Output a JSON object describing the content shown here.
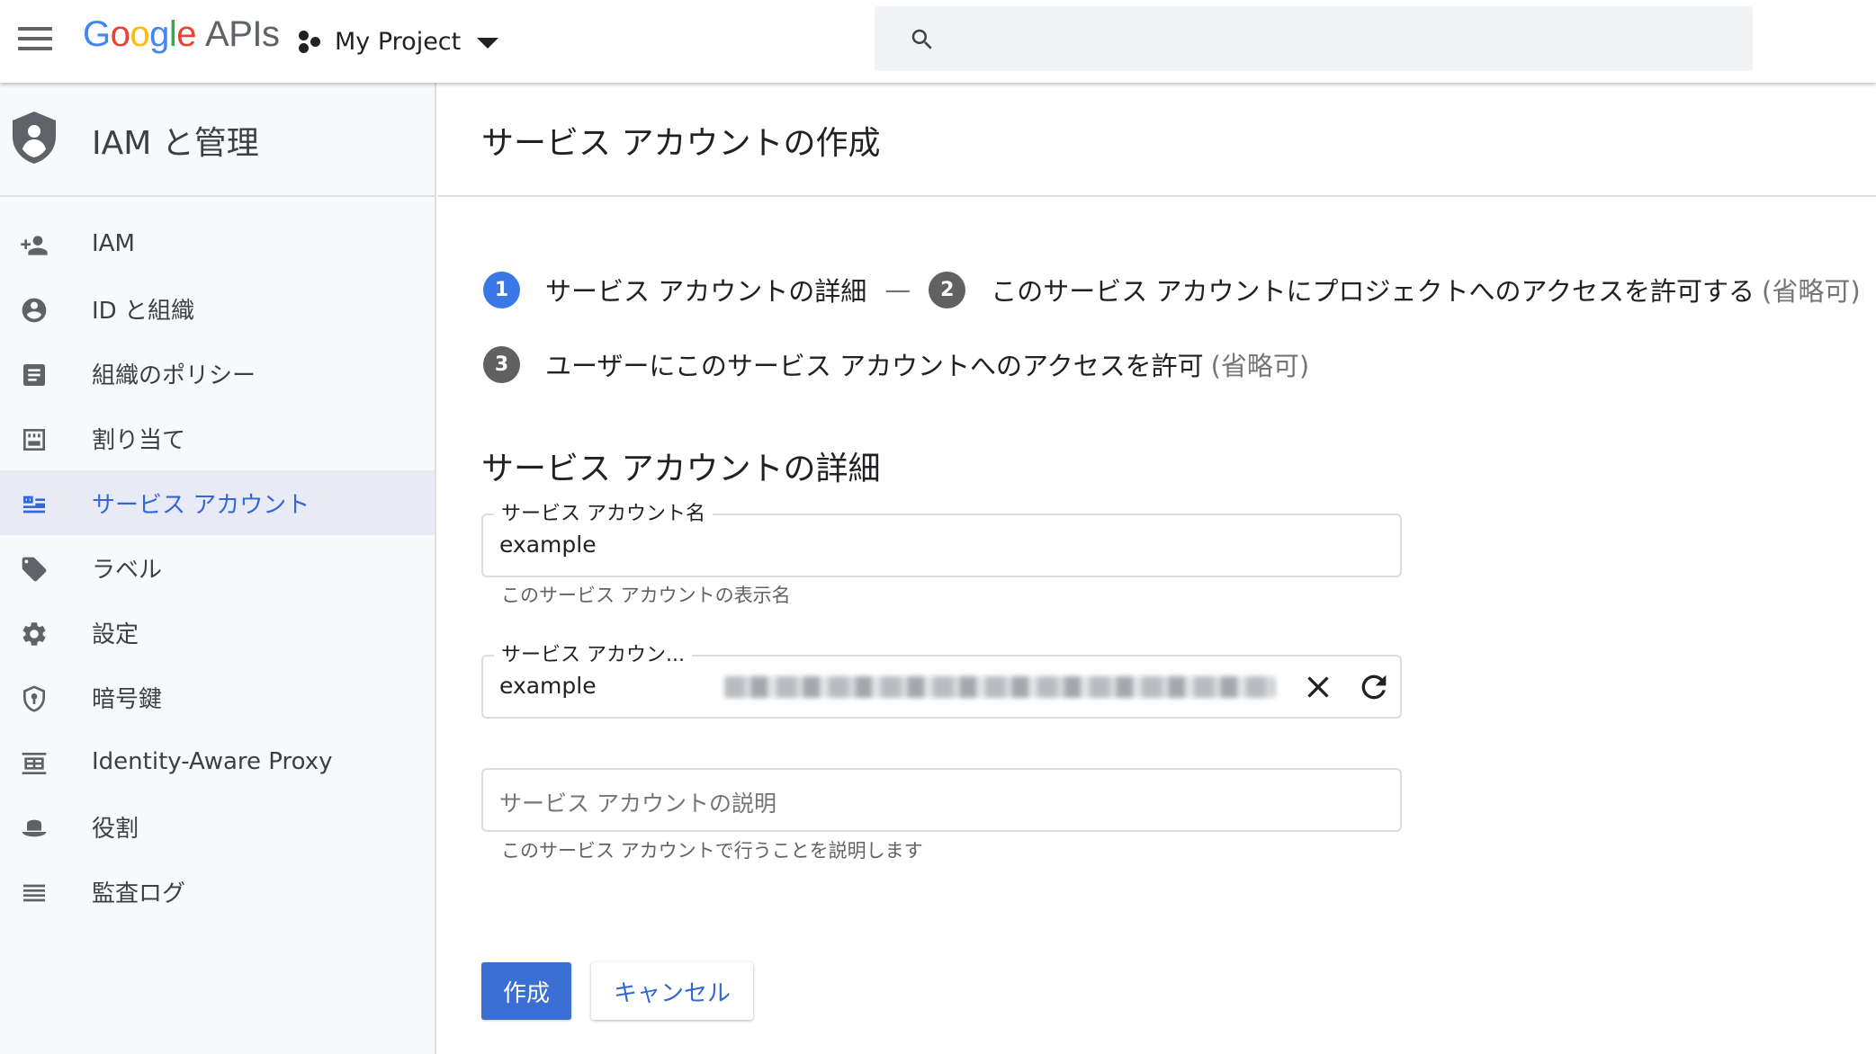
{
  "header": {
    "logo_google": "Google",
    "logo_apis": "APIs",
    "project_name": "My Project"
  },
  "sidebar": {
    "title": "IAM と管理",
    "items": [
      {
        "label": "IAM",
        "icon": "person-add-icon"
      },
      {
        "label": "ID と組織",
        "icon": "account-circle-icon"
      },
      {
        "label": "組織のポリシー",
        "icon": "document-icon"
      },
      {
        "label": "割り当て",
        "icon": "quota-icon"
      },
      {
        "label": "サービス アカウント",
        "icon": "service-account-icon",
        "active": true
      },
      {
        "label": "ラベル",
        "icon": "label-tag-icon"
      },
      {
        "label": "設定",
        "icon": "gear-icon"
      },
      {
        "label": "暗号鍵",
        "icon": "shield-key-icon"
      },
      {
        "label": "Identity-Aware Proxy",
        "icon": "proxy-icon"
      },
      {
        "label": "役割",
        "icon": "hat-icon"
      },
      {
        "label": "監査ログ",
        "icon": "list-icon"
      }
    ]
  },
  "main": {
    "title": "サービス アカウントの作成",
    "steps": [
      {
        "number": "1",
        "label": "サービス アカウントの詳細",
        "optional": ""
      },
      {
        "number": "2",
        "label": "このサービス アカウントにプロジェクトへのアクセスを許可する",
        "optional": "(省略可)"
      },
      {
        "number": "3",
        "label": "ユーザーにこのサービス アカウントへのアクセスを許可",
        "optional": "(省略可)"
      }
    ],
    "step_separator": "—",
    "section_title": "サービス アカウントの詳細",
    "fields": {
      "name": {
        "label": "サービス アカウント名",
        "value": "example",
        "hint": "このサービス アカウントの表示名"
      },
      "id": {
        "label": "サービス アカウン...",
        "value": "example"
      },
      "description": {
        "placeholder": "サービス アカウントの説明",
        "hint": "このサービス アカウントで行うことを説明します"
      }
    },
    "buttons": {
      "create": "作成",
      "cancel": "キャンセル"
    }
  },
  "colors": {
    "accent": "#3367d6",
    "primary_button": "#3b6fd4",
    "active_step": "#3b78e7",
    "inactive_step": "#616161",
    "active_nav_bg": "#e8eaf6"
  }
}
